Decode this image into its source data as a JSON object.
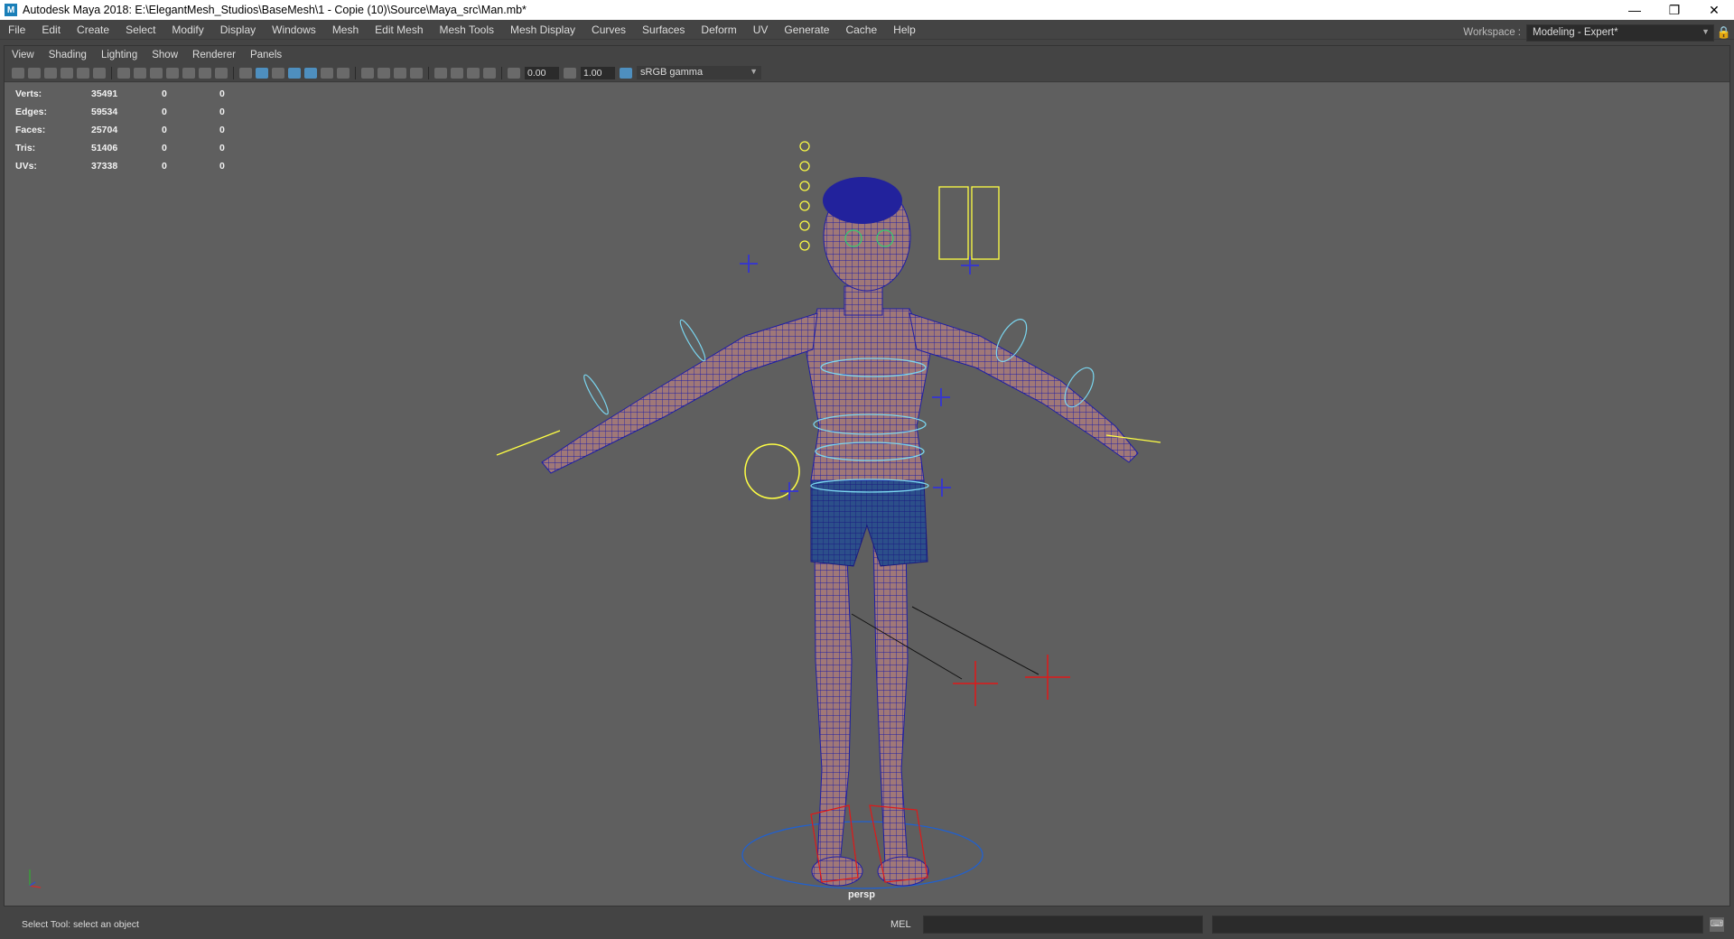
{
  "window": {
    "title": "Autodesk Maya 2018: E:\\ElegantMesh_Studios\\BaseMesh\\1 - Copie (10)\\Source\\Maya_src\\Man.mb*",
    "app_icon": "M",
    "controls": {
      "minimize": "—",
      "restore": "❐",
      "close": "✕"
    }
  },
  "menubar": {
    "items": [
      "File",
      "Edit",
      "Create",
      "Select",
      "Modify",
      "Display",
      "Windows",
      "Mesh",
      "Edit Mesh",
      "Mesh Tools",
      "Mesh Display",
      "Curves",
      "Surfaces",
      "Deform",
      "UV",
      "Generate",
      "Cache",
      "Help"
    ]
  },
  "workspace": {
    "label": "Workspace :",
    "value": "Modeling - Expert*",
    "lock_icon": "🔒"
  },
  "panel_menu": {
    "items": [
      "View",
      "Shading",
      "Lighting",
      "Show",
      "Renderer",
      "Panels"
    ]
  },
  "panel_toolbar": {
    "exposure": "0.00",
    "gamma": "1.00",
    "color_space": "sRGB gamma"
  },
  "hud": {
    "rows": [
      {
        "label": "Verts:",
        "v1": "35491",
        "v2": "0",
        "v3": "0"
      },
      {
        "label": "Edges:",
        "v1": "59534",
        "v2": "0",
        "v3": "0"
      },
      {
        "label": "Faces:",
        "v1": "25704",
        "v2": "0",
        "v3": "0"
      },
      {
        "label": "Tris:",
        "v1": "51406",
        "v2": "0",
        "v3": "0"
      },
      {
        "label": "UVs:",
        "v1": "37338",
        "v2": "0",
        "v3": "0"
      }
    ]
  },
  "viewport": {
    "camera_label": "persp",
    "colors": {
      "mesh_wire": "#1e1ea6",
      "skin": "#a07878",
      "shorts": "#2c4f8a",
      "control_cyan": "#7ad6f0",
      "control_yellow": "#ffff44",
      "control_red": "#e01818"
    }
  },
  "statusbar": {
    "message": "Select Tool: select an object",
    "mel_label": "MEL"
  }
}
